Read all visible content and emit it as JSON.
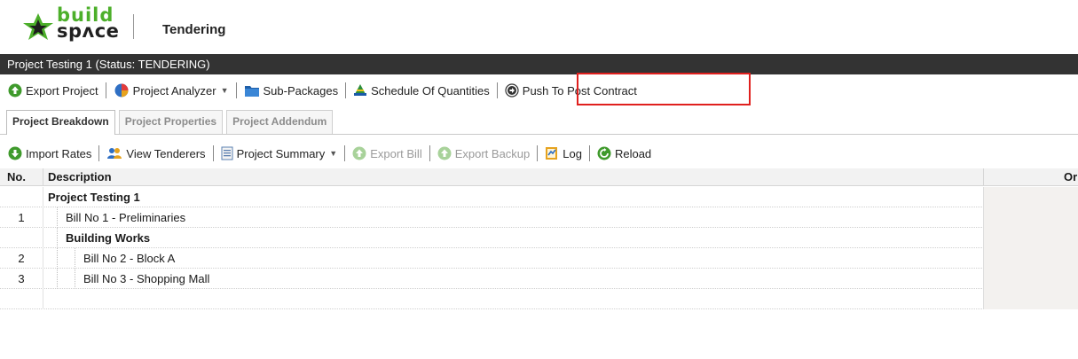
{
  "header": {
    "logo_line1": "build",
    "logo_line2": "spʌce",
    "section_title": "Tendering"
  },
  "project_bar": {
    "title": "Project Testing 1 (Status: TENDERING)"
  },
  "toolbar1": {
    "export_project": "Export Project",
    "project_analyzer": "Project Analyzer",
    "sub_packages": "Sub-Packages",
    "schedule_of_quantities": "Schedule Of Quantities",
    "push_to_post_contract": "Push To Post Contract"
  },
  "tabs": [
    {
      "label": "Project Breakdown",
      "active": true
    },
    {
      "label": "Project Properties",
      "active": false
    },
    {
      "label": "Project Addendum",
      "active": false
    }
  ],
  "toolbar2": {
    "import_rates": "Import Rates",
    "view_tenderers": "View Tenderers",
    "project_summary": "Project Summary",
    "export_bill": "Export Bill",
    "export_backup": "Export Backup",
    "log": "Log",
    "reload": "Reload"
  },
  "grid": {
    "col_no": "No.",
    "col_description": "Description",
    "col_right_partial": "Or",
    "rows": [
      {
        "no": "",
        "description": "Project Testing 1",
        "bold": true,
        "level": 0
      },
      {
        "no": "1",
        "description": "Bill No 1 - Preliminaries",
        "bold": false,
        "level": 1
      },
      {
        "no": "",
        "description": "Building Works",
        "bold": true,
        "level": 1
      },
      {
        "no": "2",
        "description": "Bill No 2 - Block A",
        "bold": false,
        "level": 2
      },
      {
        "no": "3",
        "description": "Bill No 3 - Shopping Mall",
        "bold": false,
        "level": 2
      },
      {
        "no": "",
        "description": "",
        "bold": false,
        "level": 0
      }
    ]
  },
  "colors": {
    "brand_green": "#4caf2a",
    "project_bar_bg": "#333333",
    "highlight_red": "#e0201e"
  }
}
